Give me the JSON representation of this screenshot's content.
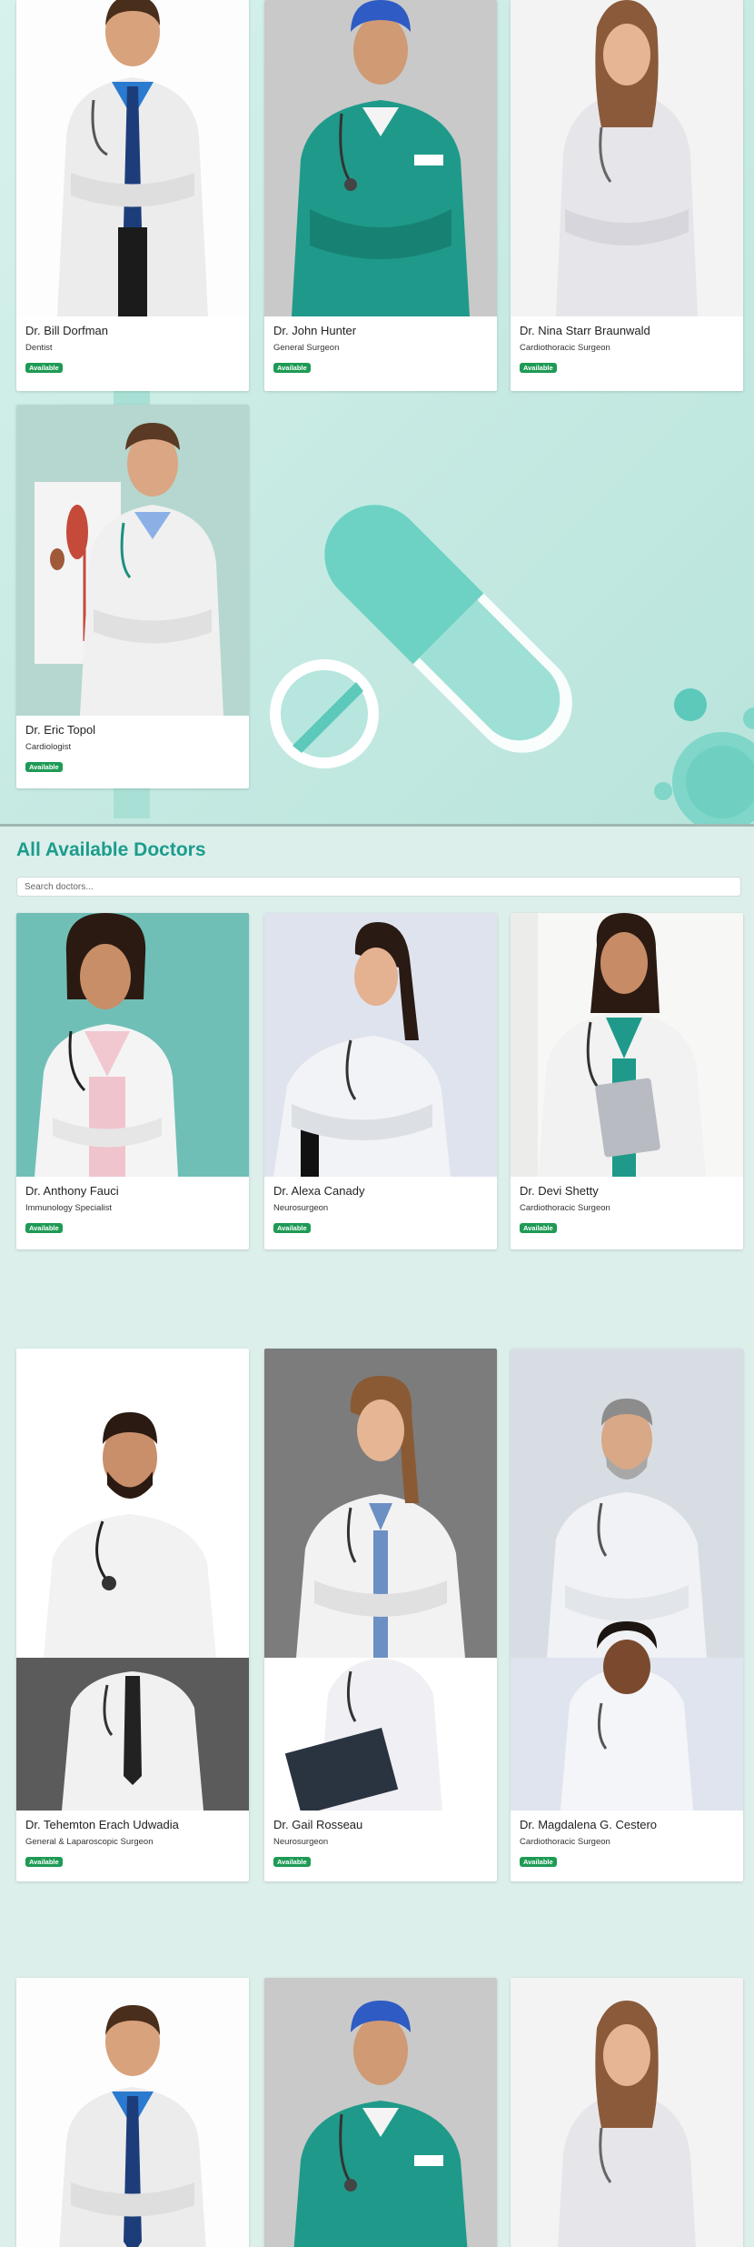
{
  "colors": {
    "accent": "#1b9c8c",
    "badge": "#1e9a55",
    "section_bg": "#d9efea"
  },
  "featured": {
    "doctors": [
      {
        "name": "Dr. Bill Dorfman",
        "specialty": "Dentist",
        "status": "Available"
      },
      {
        "name": "Dr. John Hunter",
        "specialty": "General Surgeon",
        "status": "Available"
      },
      {
        "name": "Dr. Nina Starr Braunwald",
        "specialty": "Cardiothoracic Surgeon",
        "status": "Available"
      },
      {
        "name": "Dr. Eric Topol",
        "specialty": "Cardiologist",
        "status": "Available"
      }
    ]
  },
  "all_doctors": {
    "title": "All Available Doctors",
    "search_placeholder": "Search doctors...",
    "doctors": [
      {
        "name": "Dr. Anthony Fauci",
        "specialty": "Immunology Specialist",
        "status": "Available"
      },
      {
        "name": "Dr. Alexa Canady",
        "specialty": "Neurosurgeon",
        "status": "Available"
      },
      {
        "name": "Dr. Devi Shetty",
        "specialty": "Cardiothoracic Surgeon",
        "status": "Available"
      },
      {
        "name": "Dr. Tehemton Erach Udwadia",
        "specialty": "General & Laparoscopic Surgeon",
        "status": "Available"
      },
      {
        "name": "Dr. Gail Rosseau",
        "specialty": "Neurosurgeon",
        "status": "Available"
      },
      {
        "name": "Dr. Magdalena G. Cestero",
        "specialty": "Cardiothoracic Surgeon",
        "status": "Available"
      }
    ]
  }
}
